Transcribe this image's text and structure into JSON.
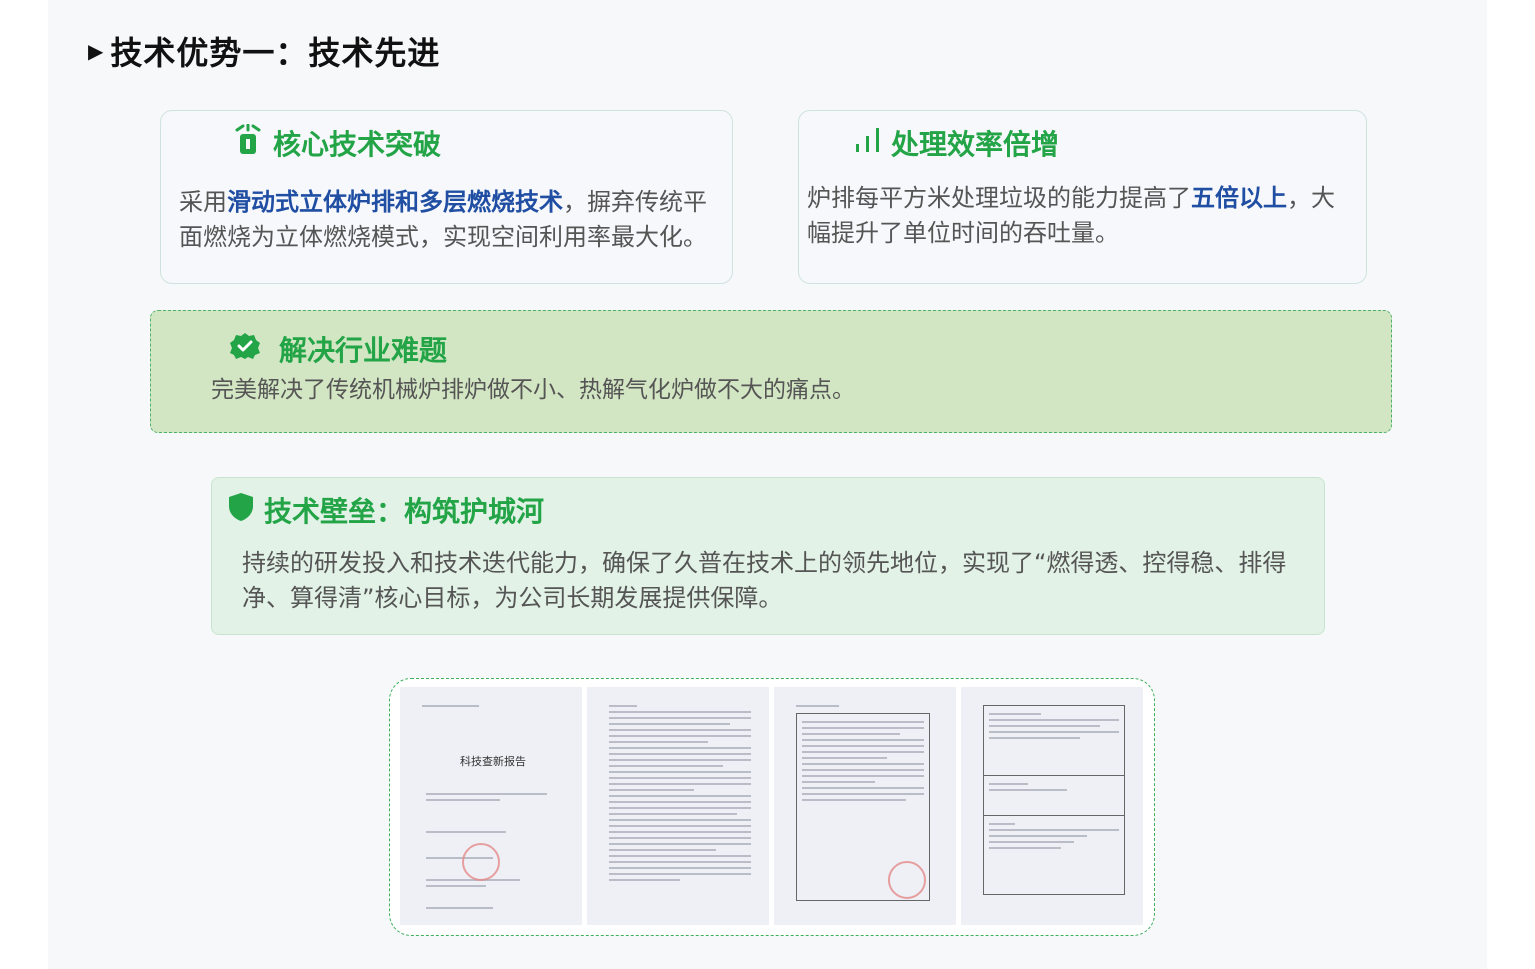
{
  "heading": {
    "marker": "▶",
    "text": "技术优势一：技术先进"
  },
  "cards": {
    "core": {
      "icon": "tech-icon",
      "title": "核心技术突破",
      "body_pre": "采用",
      "body_hl": "滑动式立体炉排和多层燃烧技术",
      "body_post": "，摒弃传统平面燃烧为立体燃烧模式，实现空间利用率最大化。"
    },
    "efficiency": {
      "icon": "bar-chart-icon",
      "title": "处理效率倍增",
      "body_pre": "炉排每平方米处理垃圾的能力提高了",
      "body_hl": "五倍以上",
      "body_post": "，大幅提升了单位时间的吞吐量。"
    },
    "industry": {
      "icon": "check-badge-icon",
      "title": "解决行业难题",
      "body": "完美解决了传统机械炉排炉做不小、热解气化炉做不大的痛点。"
    },
    "barrier": {
      "icon": "shield-icon",
      "title": "技术壁垒：构筑护城河",
      "body": "持续的研发投入和技术迭代能力，确保了久普在技术上的领先地位，实现了“燃得透、控得稳、排得净、算得清”核心目标，为公司长期发展提供保障。"
    }
  },
  "documents": {
    "report_title": "科技查新报告"
  },
  "colors": {
    "accent_green": "#22a447",
    "highlight_blue": "#1f4ea3",
    "body_text": "#555555"
  }
}
